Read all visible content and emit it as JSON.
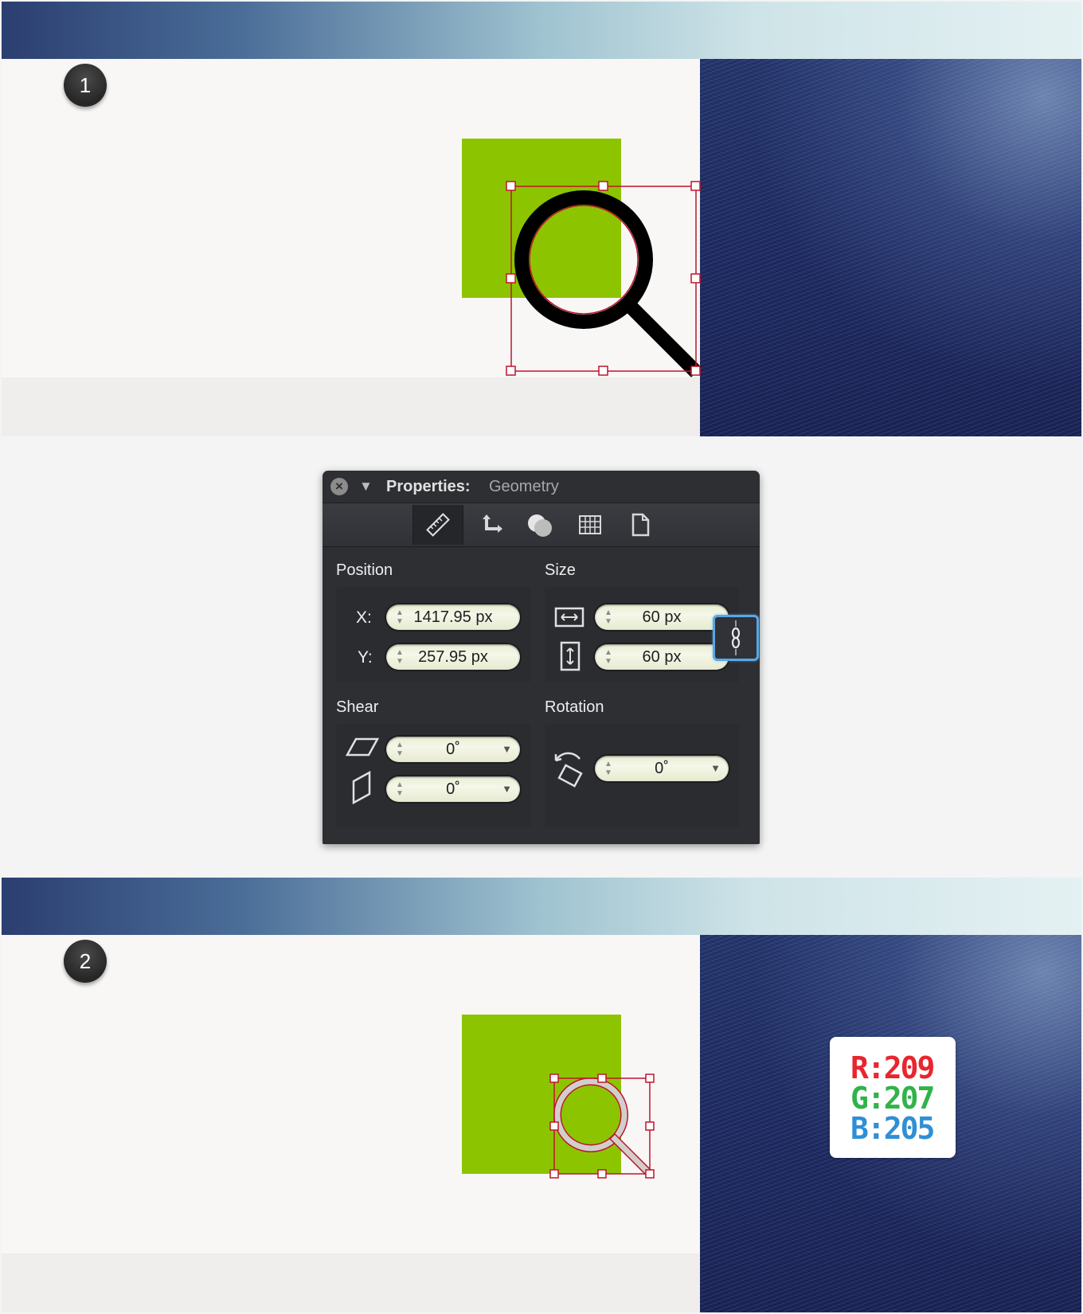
{
  "steps": [
    {
      "number": "1"
    },
    {
      "number": "2"
    }
  ],
  "rgb_swatch": {
    "r": "R:209",
    "g": "G:207",
    "b": "B:205"
  },
  "colors": {
    "green": "#8dc400",
    "selection": "#c0142a",
    "magnifier_step1": "#000000",
    "magnifier_step2_fill": "#d1cfcd"
  },
  "panel": {
    "title": "Properties:",
    "subtitle": "Geometry",
    "toolbar_icons": [
      "ruler-icon",
      "move-icon",
      "boolean-icon",
      "grid-icon",
      "page-icon"
    ],
    "position": {
      "label": "Position",
      "x_label": "X:",
      "x_value": "1417.95 px",
      "y_label": "Y:",
      "y_value": "257.95 px"
    },
    "size": {
      "label": "Size",
      "width_value": "60 px",
      "height_value": "60 px"
    },
    "shear": {
      "label": "Shear",
      "h_value": "0˚",
      "v_value": "0˚"
    },
    "rotation": {
      "label": "Rotation",
      "value": "0˚"
    }
  }
}
